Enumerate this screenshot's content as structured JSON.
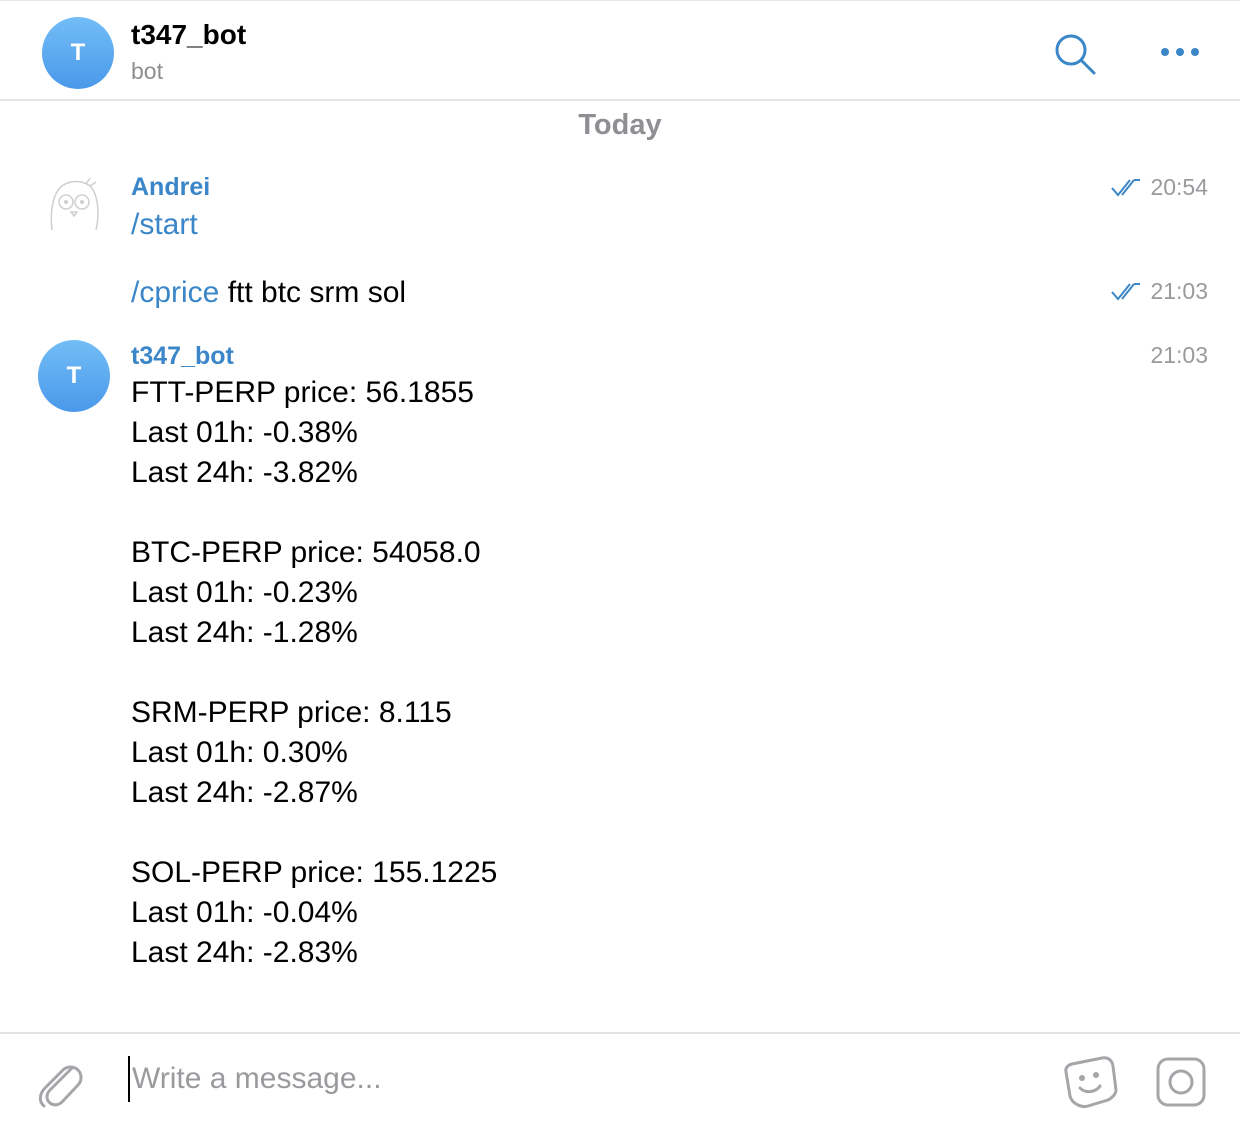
{
  "header": {
    "avatar_letter": "T",
    "title": "t347_bot",
    "subtitle": "bot"
  },
  "date_divider": "Today",
  "messages": [
    {
      "sender": "Andrei",
      "command": "/start",
      "args": "",
      "time": "20:54",
      "read": true
    },
    {
      "sender": "",
      "command": "/cprice",
      "args": " ftt btc srm sol",
      "time": "21:03",
      "read": true
    },
    {
      "sender": "t347_bot",
      "avatar_letter": "T",
      "time": "21:03",
      "lines": [
        "FTT-PERP price: 56.1855",
        "Last 01h: -0.38%",
        "Last 24h: -3.82%",
        "",
        "BTC-PERP price: 54058.0",
        "Last 01h: -0.23%",
        "Last 24h: -1.28%",
        "",
        "SRM-PERP price: 8.115",
        "Last 01h: 0.30%",
        "Last 24h: -2.87%",
        "",
        "SOL-PERP price: 155.1225",
        "Last 01h: -0.04%",
        "Last 24h: -2.83%"
      ]
    }
  ],
  "composer": {
    "placeholder": "Write a message..."
  },
  "icons": {
    "search": "search-icon",
    "more": "more-icon",
    "attach": "paperclip-icon",
    "sticker": "sticker-icon",
    "camera": "camera-icon",
    "read_receipt": "double-check-icon"
  },
  "colors": {
    "accent": "#3a86c8",
    "avatar_gradient_top": "#72bdf6",
    "avatar_gradient_bottom": "#4a99ea",
    "muted": "#8e8e93"
  }
}
